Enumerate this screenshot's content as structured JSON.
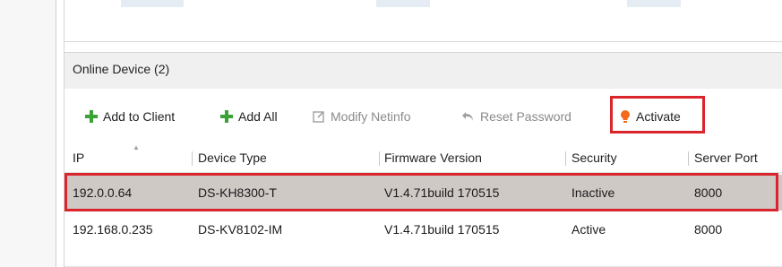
{
  "section": {
    "title": "Online Device (2)"
  },
  "toolbar": {
    "add_to_client": "Add to Client",
    "add_all": "Add All",
    "modify_netinfo": "Modify Netinfo",
    "reset_password": "Reset Password",
    "activate": "Activate"
  },
  "table": {
    "headers": [
      "IP",
      "Device Type",
      "Firmware Version",
      "Security",
      "Server Port"
    ],
    "rows": [
      {
        "ip": "192.0.0.64",
        "device_type": "DS-KH8300-T",
        "firmware": "V1.4.71build 170515",
        "security": "Inactive",
        "port": "8000"
      },
      {
        "ip": "192.168.0.235",
        "device_type": "DS-KV8102-IM",
        "firmware": "V1.4.71build 170515",
        "security": "Active",
        "port": "8000"
      }
    ]
  },
  "colors": {
    "highlight": "#d9252b",
    "plus": "#3aa335",
    "activate": "#f26b1d",
    "selected_row": "#cfc9c6"
  },
  "icons": {
    "add": "plus-icon",
    "modify": "edit-box-icon",
    "reset": "undo-arrow-icon",
    "activate": "lightbulb-icon"
  }
}
